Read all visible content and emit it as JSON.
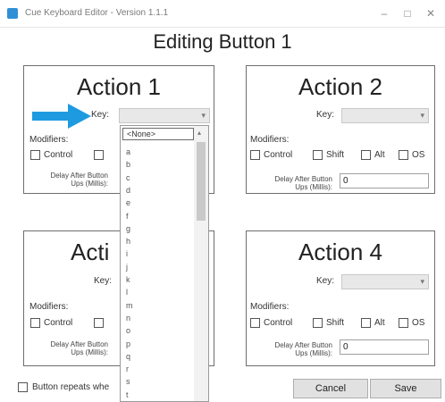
{
  "window": {
    "title": "Cue Keyboard Editor - Version 1.1.1",
    "minimize_glyph": "–",
    "maximize_glyph": "□",
    "close_glyph": "✕"
  },
  "heading": "Editing Button 1",
  "key_label": "Key:",
  "modifiers_label": "Modifiers:",
  "modifier_labels": {
    "control": "Control",
    "shift": "Shift",
    "alt": "Alt",
    "os": "OS"
  },
  "delay_label_line1": "Delay After Button",
  "delay_label_line2": "Ups (Millis):",
  "actions": [
    {
      "title": "Action 1",
      "delay": ""
    },
    {
      "title": "Action 2",
      "delay": "0"
    },
    {
      "title": "Acti",
      "delay": ""
    },
    {
      "title": "Action 4",
      "delay": "0"
    }
  ],
  "dropdown": {
    "first": "<None>",
    "items": [
      "a",
      "b",
      "c",
      "d",
      "e",
      "f",
      "g",
      "h",
      "i",
      "j",
      "k",
      "l",
      "m",
      "n",
      "o",
      "p",
      "q",
      "r",
      "s",
      "t"
    ]
  },
  "repeat_label": "Button repeats whe",
  "buttons": {
    "cancel": "Cancel",
    "save": "Save"
  },
  "colors": {
    "accent_arrow": "#1e9be0",
    "group_border": "#6e6e6e"
  }
}
